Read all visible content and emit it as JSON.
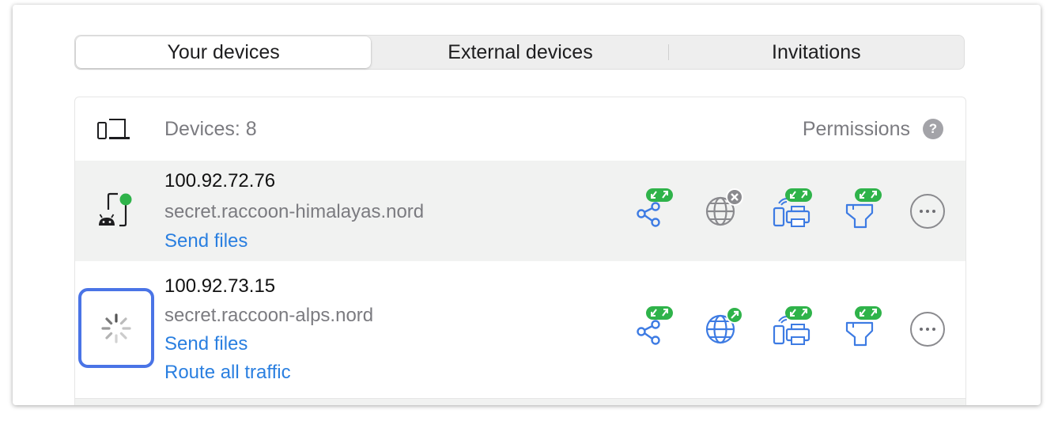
{
  "tabs": [
    {
      "label": "Your devices",
      "active": true
    },
    {
      "label": "External devices",
      "active": false
    },
    {
      "label": "Invitations",
      "active": false
    }
  ],
  "panel": {
    "devices_label": "Devices: 8",
    "permissions_label": "Permissions",
    "help_glyph": "?"
  },
  "devices": [
    {
      "ip": "100.92.72.76",
      "hostname": "secret.raccoon-himalayas.nord",
      "links": [
        "Send files"
      ],
      "platform": "android-icon",
      "status": "online",
      "permissions": {
        "file_sharing": "allowed-both",
        "routing": "blocked",
        "local_network": "allowed-both",
        "nordlynx": "allowed-both"
      }
    },
    {
      "ip": "100.92.73.15",
      "hostname": "secret.raccoon-alps.nord",
      "links": [
        "Send files",
        "Route all traffic"
      ],
      "platform": "loading-spinner",
      "status": "loading",
      "permissions": {
        "file_sharing": "allowed-both",
        "routing": "allowed-outgoing",
        "local_network": "allowed-both",
        "nordlynx": "allowed-both"
      }
    }
  ],
  "colors": {
    "accent_blue": "#2a7fe0",
    "icon_blue": "#3d7be3",
    "badge_green": "#2fb34a",
    "badge_grey": "#8a8a8e",
    "focus_ring": "#4a74e6",
    "row_highlight": "#f1f2f1"
  }
}
